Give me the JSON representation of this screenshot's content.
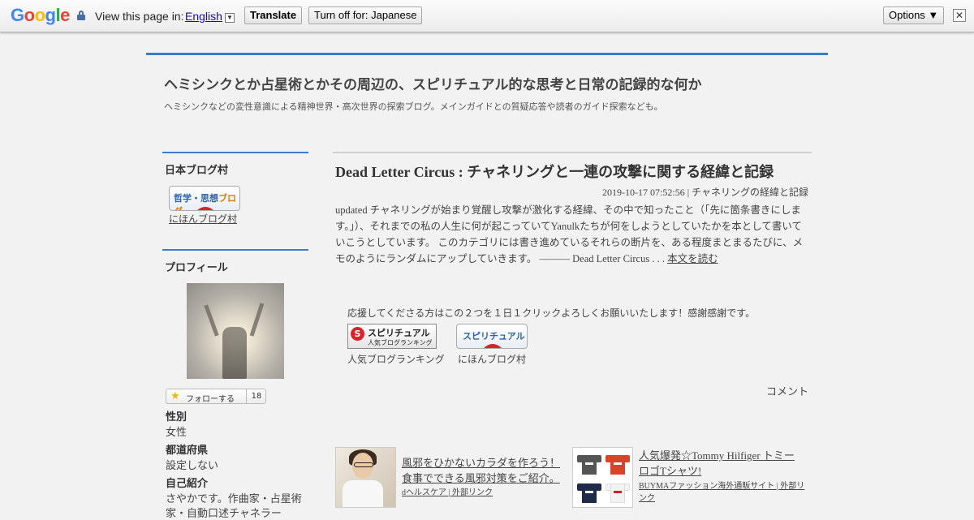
{
  "translate_bar": {
    "logo_letters": [
      "G",
      "o",
      "o",
      "g",
      "l",
      "e"
    ],
    "view_label": "View this page in:",
    "language": "English",
    "translate_button": "Translate",
    "turn_off_button": "Turn off for: Japanese",
    "options_button": "Options ▼",
    "close_glyph": "✕"
  },
  "site": {
    "title": "ヘミシンクとか占星術とかその周辺の、スピリチュアル的な思考と日常の記録的な何か",
    "description": "ヘミシンクなどの変性意識による精神世界・高次世界の探索ブログ。メインガイドとの質疑応答や読者のガイド探索なども。"
  },
  "sidebar": {
    "blog_village_heading": "日本ブログ村",
    "blog_village_banner": {
      "text_a": "哲学・思想",
      "text_b": "ブログ"
    },
    "blog_village_link": "にほんブログ村",
    "profile_heading": "プロフィール",
    "follow": {
      "label": "フォローする",
      "count": "18"
    },
    "profile_fields": [
      {
        "label": "性別",
        "value": "女性"
      },
      {
        "label": "都道府県",
        "value": "設定しない"
      },
      {
        "label": "自己紹介",
        "value": "さやかです。作曲家・占星術"
      },
      {
        "label": "",
        "value": "家・自動口述チャネラー"
      }
    ]
  },
  "post": {
    "title": "Dead Letter Circus : チャネリングと一連の攻撃に関する経緯と記録",
    "meta": "2019-10-17 07:52:56 | チャネリングの経緯と記録",
    "body": "updated チャネリングが始まり覚醒し攻撃が激化する経緯、その中で知ったこと（「先に箇条書きにします。」）、それまでの私の人生に何が起こっていてYanulkたちが何をしようとしていたかを本として書いていこうとしています。 このカテゴリには書き進めているそれらの断片を、ある程度まとまるたびに、メモのようにランダムにアップしていきます。 ――― Dead Letter Circus . . . ",
    "read_more": "本文を読む",
    "support_text": "応援してくださる方はこの２つを１日１クリックよろしくお願いいたします！感謝感謝です。",
    "ranking_banner": {
      "logo": "S",
      "line1": "スピリチュアル",
      "line2": "人気ブログランキング"
    },
    "ranking_caption": "人気ブログランキング",
    "mura_banner": {
      "text": "スピリチュアル"
    },
    "mura_caption": "にほんブログ村",
    "comment_label": "コメント"
  },
  "ads": [
    {
      "title": "風邪をひかないカラダを作ろう！食事でできる風邪対策をご紹介。",
      "source": "dヘルスケア | 外部リンク"
    },
    {
      "title": "人気爆発☆Tommy Hilfiger トミーロゴTシャツ!",
      "source": "BUYMAファッション海外通販サイト | 外部リンク"
    }
  ],
  "colors": {
    "accent": "#3a7cc9",
    "ranking_red": "#d8242b"
  }
}
